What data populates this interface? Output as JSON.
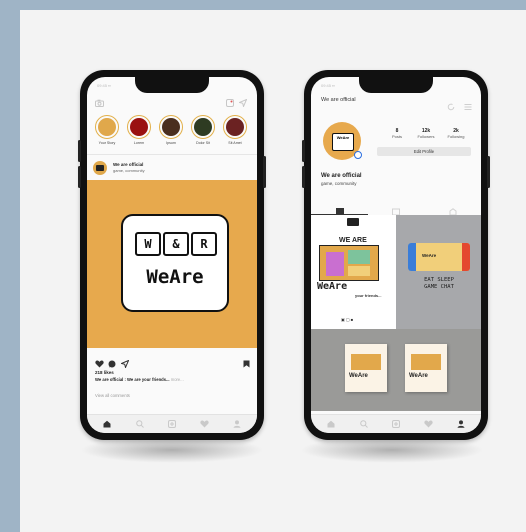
{
  "feed_phone": {
    "status_text": "09:45 ▪▪",
    "stories": [
      {
        "label": "Your Story",
        "color": "#e0a84b"
      },
      {
        "label": "Lorem",
        "color": "#9a1111"
      },
      {
        "label": "Ipsum",
        "color": "#4a2e1e"
      },
      {
        "label": "Dolor Sit",
        "color": "#2e3b22"
      },
      {
        "label": "Sit Amet",
        "color": "#6b2222"
      }
    ],
    "post": {
      "account_name": "We are official",
      "account_sub": "game, community",
      "logo_letters": [
        "W",
        "&",
        "R"
      ],
      "logo_text": "WeAre",
      "likes": "218 likes",
      "caption": "We are official : We are your friends...",
      "caption_more": "more...",
      "view_comments": "View all comments",
      "bg_color": "#e7a94d"
    }
  },
  "profile_phone": {
    "status_text": "09:45 ▪▪",
    "header_title": "We are official",
    "avatar_text": "WeAre",
    "stats": [
      {
        "number": "8",
        "label": "Posts"
      },
      {
        "number": "12k",
        "label": "Followers"
      },
      {
        "number": "2k",
        "label": "Following"
      }
    ],
    "edit_button": "Edit Profile",
    "name": "We are official",
    "bio": "game, community",
    "grid": [
      {
        "title": "WE ARE",
        "caption": "WeAre",
        "sub": "your friends..."
      },
      {
        "title": "EAT SLEEP GAME CHAT",
        "device_label": "WeAre"
      },
      {
        "left_caption": "WeAre",
        "right_caption": "WeAre"
      }
    ]
  },
  "icons": [
    "camera-icon",
    "heart-icon",
    "send-icon",
    "comment-icon",
    "bookmark-icon",
    "home-icon",
    "search-icon",
    "add-icon",
    "profile-icon",
    "menu-icon",
    "refresh-icon",
    "grid-icon",
    "tag-icon"
  ]
}
